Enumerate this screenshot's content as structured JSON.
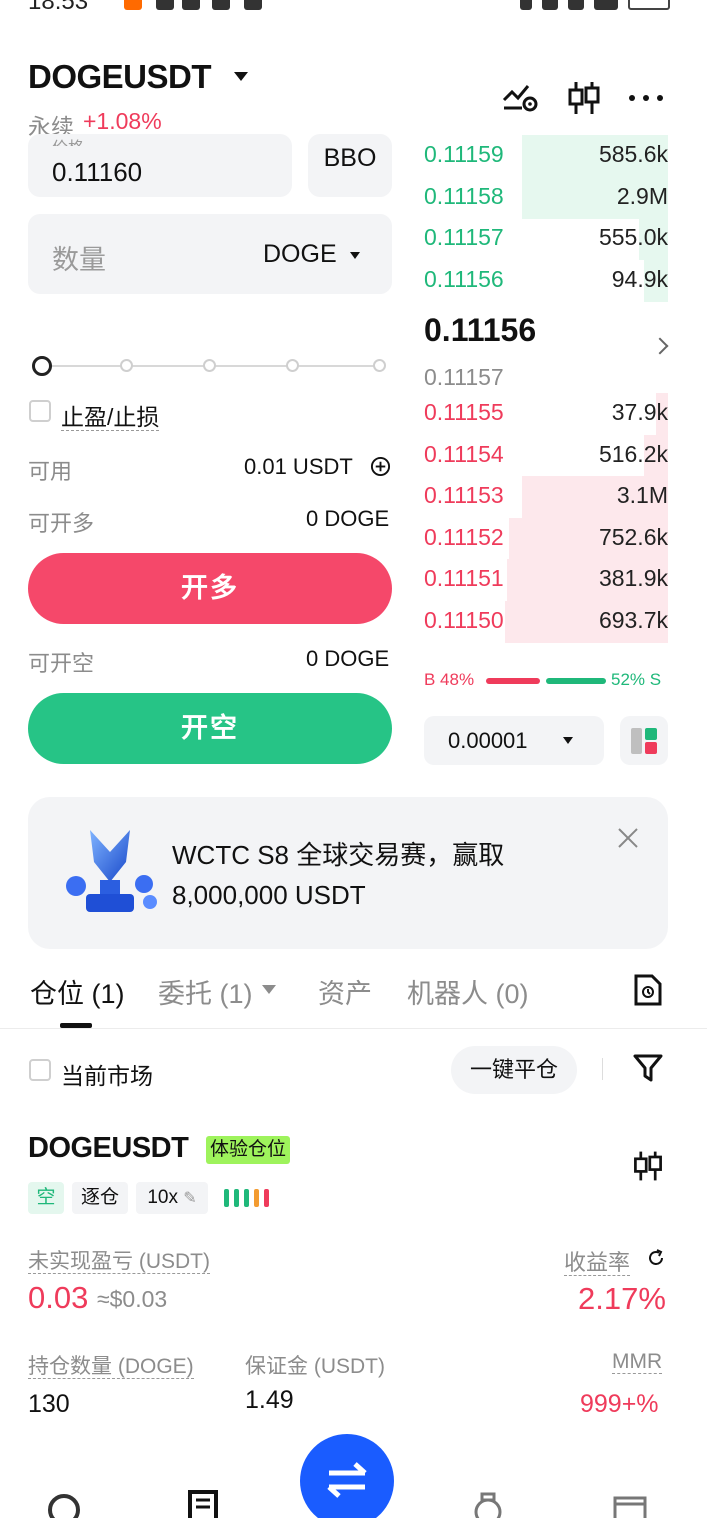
{
  "status_bar": {
    "time": "18:53"
  },
  "header": {
    "pair": "DOGEUSDT",
    "contract_type": "永续",
    "change": "+1.08%",
    "icons": [
      "chart-line-icon",
      "candlestick-icon",
      "more-icon"
    ]
  },
  "order_form": {
    "price_label": "价格",
    "price_value": "0.11160",
    "bbo_label": "BBO",
    "quantity_placeholder": "数量",
    "quantity_unit": "DOGE",
    "tpsl_label": "止盈/止损",
    "available_label": "可用",
    "available_value": "0.01 USDT",
    "max_long_label": "可开多",
    "max_long_value": "0 DOGE",
    "open_long_label": "开多",
    "max_short_label": "可开空",
    "max_short_value": "0 DOGE",
    "open_short_label": "开空"
  },
  "order_book": {
    "asks_top": [
      {
        "price": "0.11159",
        "qty": "585.6k",
        "depth": 0.6
      },
      {
        "price": "0.11158",
        "qty": "2.9M",
        "depth": 0.6
      },
      {
        "price": "0.11157",
        "qty": "555.0k",
        "depth": 0.12
      },
      {
        "price": "0.11156",
        "qty": "94.9k",
        "depth": 0.1
      }
    ],
    "last_price": "0.11156",
    "mark_price": "0.11157",
    "bids": [
      {
        "price": "0.11155",
        "qty": "37.9k",
        "depth": 0.05
      },
      {
        "price": "0.11154",
        "qty": "516.2k",
        "depth": 0.1
      },
      {
        "price": "0.11153",
        "qty": "3.1M",
        "depth": 0.6
      },
      {
        "price": "0.11152",
        "qty": "752.6k",
        "depth": 0.65
      },
      {
        "price": "0.11151",
        "qty": "381.9k",
        "depth": 0.66
      },
      {
        "price": "0.11150",
        "qty": "693.7k",
        "depth": 0.67
      }
    ],
    "buy_ratio": "B 48%",
    "sell_ratio": "52% S",
    "tick_size": "0.00001"
  },
  "banner": {
    "line1": "WCTC S8 全球交易赛，赢取",
    "line2": "8,000,000 USDT"
  },
  "tabs": [
    {
      "label": "仓位 (1)"
    },
    {
      "label": "委托 (1)"
    },
    {
      "label": "资产"
    },
    {
      "label": "机器人 (0)"
    }
  ],
  "filter_bar": {
    "current_market_label": "当前市场",
    "close_all_label": "一键平仓"
  },
  "position": {
    "symbol": "DOGEUSDT",
    "trial_tag": "体验仓位",
    "side": "空",
    "margin_mode": "逐仓",
    "leverage": "10x",
    "upnl_label": "未实现盈亏 (USDT)",
    "upnl_value": "0.03",
    "upnl_usd": "≈$0.03",
    "roe_label": "收益率",
    "roe_value": "2.17%",
    "size_label": "持仓数量 (DOGE)",
    "size_value": "130",
    "margin_label": "保证金 (USDT)",
    "margin_value": "1.49",
    "mmr_label": "MMR",
    "mmr_value": "999+%"
  },
  "colors": {
    "green": "#1fb87a",
    "red": "#ef3b5b",
    "fab_blue": "#1a5cff",
    "trial_tag": "#9ef35c"
  }
}
